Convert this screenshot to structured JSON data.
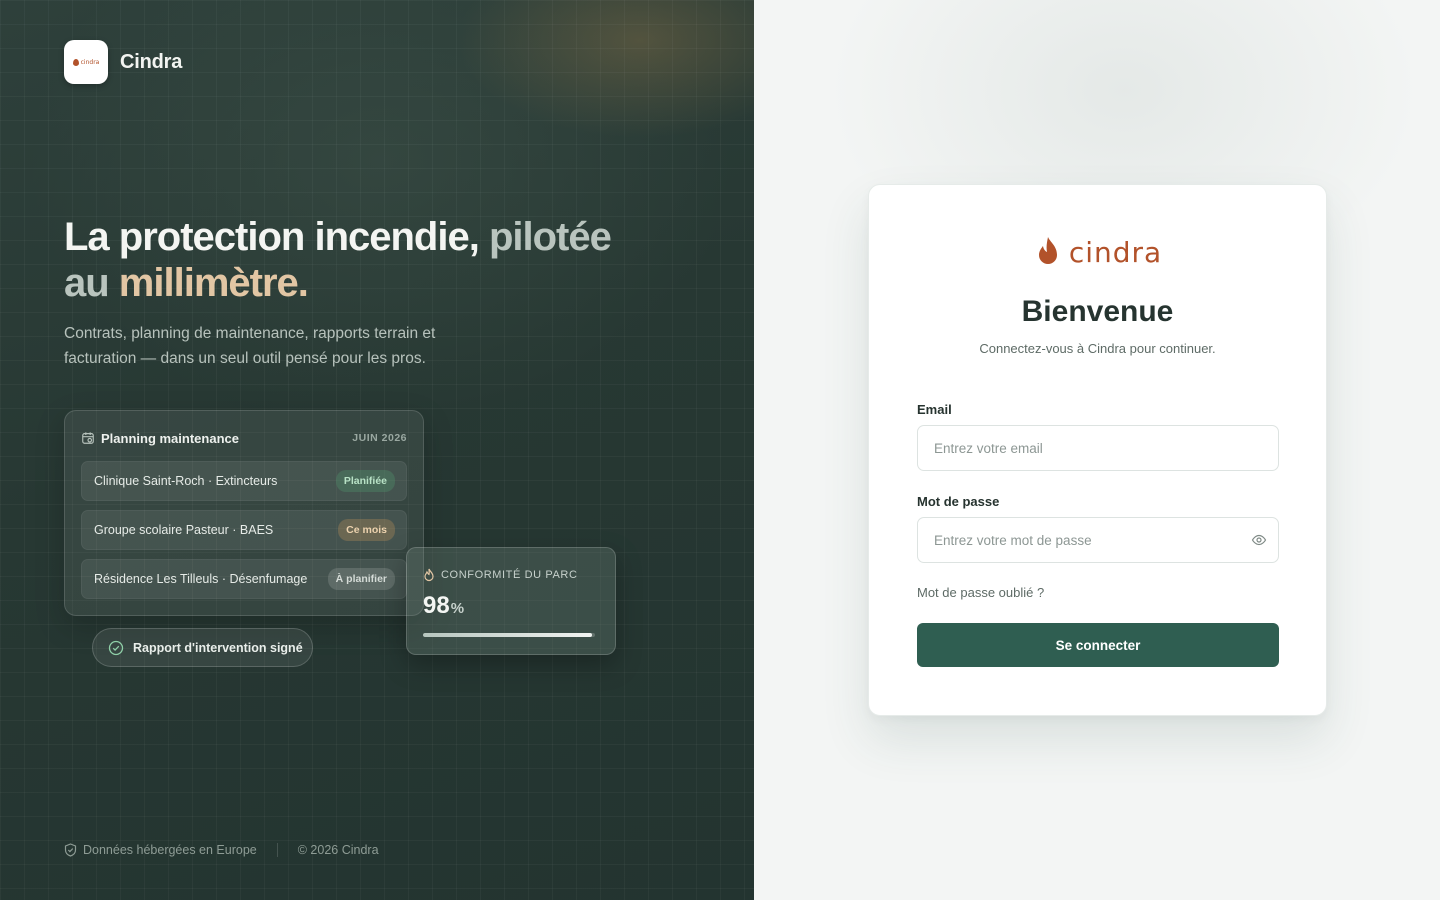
{
  "brand": {
    "name": "Cindra",
    "logo_text": "cindra"
  },
  "hero": {
    "title_part1": "La protection incendie,",
    "title_part2": " pilotée",
    "title_part3": "au",
    "title_part4": " millimètre.",
    "subtitle": "Contrats, planning de maintenance, rapports terrain et facturation — dans un seul outil pensé pour les pros."
  },
  "planning": {
    "title": "Planning maintenance",
    "date": "JUIN 2026",
    "rows": [
      {
        "label": "Clinique Saint-Roch · Extincteurs",
        "status": "Planifiée",
        "status_color": "#b8e2c6"
      },
      {
        "label": "Groupe scolaire Pasteur · BAES",
        "status": "Ce mois",
        "status_color": "#ecd2ae"
      },
      {
        "label": "Résidence Les Tilleuls · Désenfumage",
        "status": "À planifier",
        "status_color": "#d5dbd7"
      }
    ]
  },
  "conformity": {
    "label": "CONFORMITÉ DU PARC",
    "value": "98",
    "unit": "%",
    "progress": 0.98
  },
  "signed_pill": {
    "label": "Rapport d'intervention signé"
  },
  "footer": {
    "hosting": "Données hébergées en Europe",
    "copyright": "© 2026 Cindra"
  },
  "login": {
    "logo_text": "cindra",
    "title": "Bienvenue",
    "subtitle": "Connectez-vous à Cindra pour continuer.",
    "email_label": "Email",
    "email_placeholder": "Entrez votre email",
    "email_value": "",
    "password_label": "Mot de passe",
    "password_placeholder": "Entrez votre mot de passe",
    "password_value": "",
    "forgot": "Mot de passe oublié ?",
    "submit": "Se connecter"
  },
  "colors": {
    "primary": "#2f5e51",
    "brand_orange": "#b2522a",
    "accent_sand": "#e2c6a4",
    "panel_dark": "#273833"
  },
  "icons": [
    "flame-icon",
    "calendar-icon",
    "flame-icon",
    "check-circle-icon",
    "shield-icon",
    "copyright-icon",
    "eye-icon"
  ]
}
